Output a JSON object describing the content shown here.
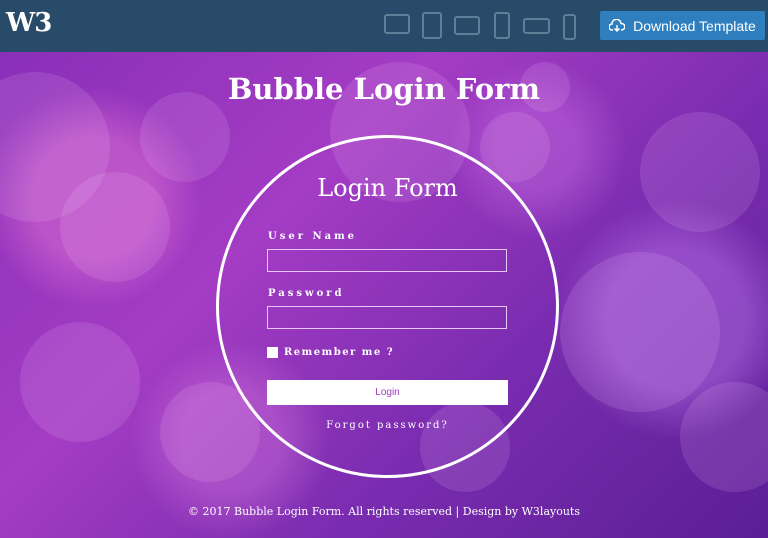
{
  "topbar": {
    "logo_text": "W3",
    "download_label": "Download Template",
    "device_icons": [
      "desktop-icon",
      "laptop-icon",
      "tablet-landscape-icon",
      "mobile-portrait-icon",
      "mobile-landscape-icon",
      "feature-phone-icon"
    ],
    "background": "#274b68",
    "button_color": "#2f7fbf"
  },
  "page": {
    "title": "Bubble Login Form"
  },
  "login_form": {
    "title": "Login Form",
    "username_label": "User Name",
    "username_value": "",
    "password_label": "Password",
    "password_value": "",
    "remember_label": "Remember me ?",
    "remember_checked": false,
    "login_button": "Login",
    "forgot_link": "Forgot password?"
  },
  "footer": {
    "text": "© 2017 Bubble Login Form. All rights reserved | Design by W3layouts"
  }
}
